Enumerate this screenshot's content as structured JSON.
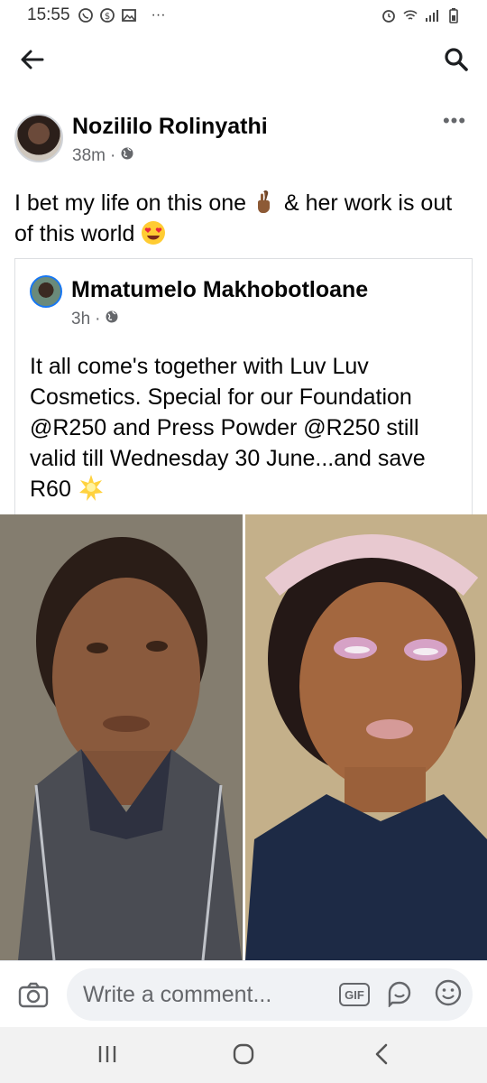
{
  "status_bar": {
    "time": "15:55",
    "dots": "···"
  },
  "post": {
    "author": "Nozililo Rolinyathi",
    "time": "38m",
    "text_part1": "I bet my life on this one",
    "text_part2": "& her work is out of this world",
    "more": "•••"
  },
  "shared": {
    "author": "Mmatumelo Makhobotloane",
    "time": "3h",
    "text": "It all come's together with Luv Luv Cosmetics. Special for our Foundation @R250 and Press Powder @R250 still valid till Wednesday 30 June...and save R60"
  },
  "comment": {
    "placeholder": "Write a comment...",
    "gif_label": "GIF"
  },
  "icons": {
    "back": "arrow-left-icon",
    "search": "search-icon",
    "globe": "globe-icon",
    "camera": "camera-icon",
    "sticker": "sticker-icon",
    "emoji": "smiley-icon"
  },
  "colors": {
    "accent": "#1877f2",
    "secondary_text": "#65676b",
    "input_bg": "#f0f2f5"
  }
}
